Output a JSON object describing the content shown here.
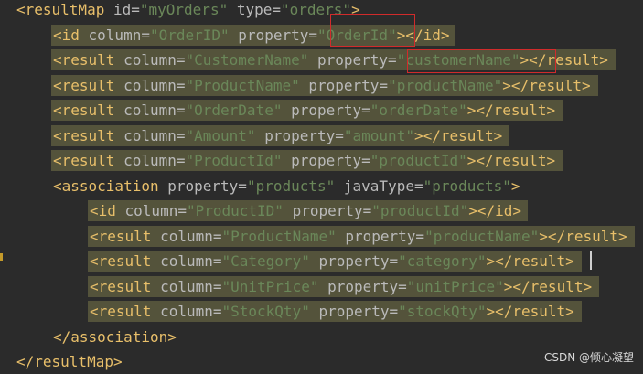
{
  "lines": [
    {
      "indent": 0,
      "parts": [
        [
          "tag",
          "<resultMap "
        ],
        [
          "attr",
          "id="
        ],
        [
          "val",
          "\"myOrders\""
        ],
        [
          "attr",
          " type="
        ],
        [
          "val",
          "\"orders\""
        ],
        [
          "tag",
          ">"
        ]
      ],
      "highlight": false
    },
    {
      "indent": 1,
      "parts": [
        [
          "tag",
          "<id "
        ],
        [
          "attr",
          "column="
        ],
        [
          "val",
          "\"OrderID\""
        ],
        [
          "attr",
          " property="
        ],
        [
          "val",
          "\"OrderId\""
        ],
        [
          "tag",
          "></id>"
        ]
      ],
      "highlight": true
    },
    {
      "indent": 1,
      "parts": [
        [
          "tag",
          "<result "
        ],
        [
          "attr",
          "column="
        ],
        [
          "val",
          "\"CustomerName\""
        ],
        [
          "attr",
          " property="
        ],
        [
          "val",
          "\"customerName\""
        ],
        [
          "tag",
          "></result>"
        ]
      ],
      "highlight": true
    },
    {
      "indent": 1,
      "parts": [
        [
          "tag",
          "<result "
        ],
        [
          "attr",
          "column="
        ],
        [
          "val",
          "\"ProductName\""
        ],
        [
          "attr",
          " property="
        ],
        [
          "val",
          "\"productName\""
        ],
        [
          "tag",
          "></result>"
        ]
      ],
      "highlight": true
    },
    {
      "indent": 1,
      "parts": [
        [
          "tag",
          "<result "
        ],
        [
          "attr",
          "column="
        ],
        [
          "val",
          "\"OrderDate\""
        ],
        [
          "attr",
          " property="
        ],
        [
          "val",
          "\"orderDate\""
        ],
        [
          "tag",
          "></result>"
        ]
      ],
      "highlight": true
    },
    {
      "indent": 1,
      "parts": [
        [
          "tag",
          "<result "
        ],
        [
          "attr",
          "column="
        ],
        [
          "val",
          "\"Amount\""
        ],
        [
          "attr",
          " property="
        ],
        [
          "val",
          "\"amount\""
        ],
        [
          "tag",
          "></result>"
        ]
      ],
      "highlight": true
    },
    {
      "indent": 1,
      "parts": [
        [
          "tag",
          "<result "
        ],
        [
          "attr",
          "column="
        ],
        [
          "val",
          "\"ProductId\""
        ],
        [
          "attr",
          " property="
        ],
        [
          "val",
          "\"productId\""
        ],
        [
          "tag",
          "></result>"
        ]
      ],
      "highlight": true
    },
    {
      "indent": 1,
      "parts": [
        [
          "tag",
          "<association "
        ],
        [
          "attr",
          "property="
        ],
        [
          "val",
          "\"products\""
        ],
        [
          "attr",
          " javaType="
        ],
        [
          "val",
          "\"products\""
        ],
        [
          "tag",
          ">"
        ]
      ],
      "highlight": false
    },
    {
      "indent": 2,
      "parts": [
        [
          "tag",
          "<id "
        ],
        [
          "attr",
          "column="
        ],
        [
          "val",
          "\"ProductID\""
        ],
        [
          "attr",
          " property="
        ],
        [
          "val",
          "\"productId\""
        ],
        [
          "tag",
          "></id>"
        ]
      ],
      "highlight": true
    },
    {
      "indent": 2,
      "parts": [
        [
          "tag",
          "<result "
        ],
        [
          "attr",
          "column="
        ],
        [
          "val",
          "\"ProductName\""
        ],
        [
          "attr",
          " property="
        ],
        [
          "val",
          "\"productName\""
        ],
        [
          "tag",
          "></result>"
        ]
      ],
      "highlight": true
    },
    {
      "indent": 2,
      "parts": [
        [
          "tag",
          "<result "
        ],
        [
          "attr",
          "column="
        ],
        [
          "val",
          "\"Category\""
        ],
        [
          "attr",
          " property="
        ],
        [
          "val",
          "\"category\""
        ],
        [
          "tag",
          "></result>"
        ]
      ],
      "highlight": true
    },
    {
      "indent": 2,
      "parts": [
        [
          "tag",
          "<result "
        ],
        [
          "attr",
          "column="
        ],
        [
          "val",
          "\"UnitPrice\""
        ],
        [
          "attr",
          " property="
        ],
        [
          "val",
          "\"unitPrice\""
        ],
        [
          "tag",
          "></result>"
        ]
      ],
      "highlight": true
    },
    {
      "indent": 2,
      "parts": [
        [
          "tag",
          "<result "
        ],
        [
          "attr",
          "column="
        ],
        [
          "val",
          "\"StockQty\""
        ],
        [
          "attr",
          " property="
        ],
        [
          "val",
          "\"stockQty\""
        ],
        [
          "tag",
          "></result>"
        ]
      ],
      "highlight": true
    },
    {
      "indent": 1,
      "parts": [
        [
          "tag",
          "</association>"
        ]
      ],
      "highlight": false
    },
    {
      "indent": 0,
      "parts": [
        [
          "tag",
          "</resultMap>"
        ]
      ],
      "highlight": false
    }
  ],
  "watermark": "CSDN @倾心凝望",
  "colors": {
    "tag": "#e8bf6a",
    "attr": "#bababa",
    "val": "#6a8759",
    "highlight": "#54533b",
    "box": "#d12b2b"
  }
}
